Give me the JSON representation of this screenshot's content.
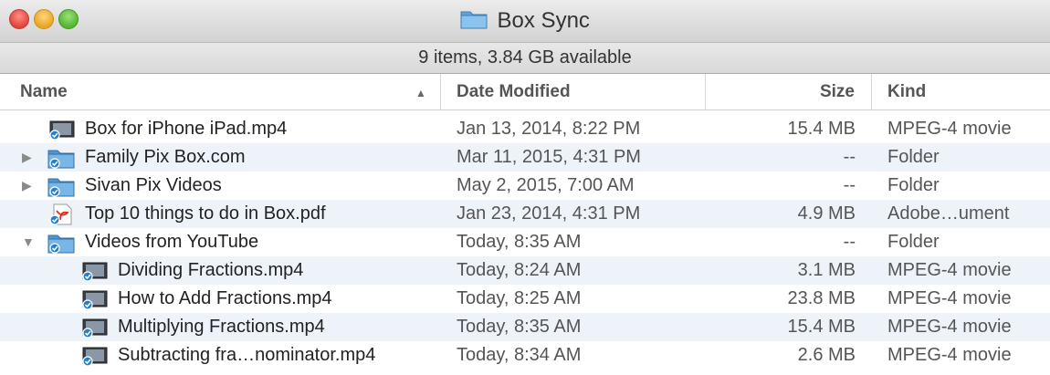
{
  "window": {
    "title": "Box Sync",
    "status": "9 items, 3.84 GB available",
    "title_icon": "folder-icon"
  },
  "columns": {
    "name": "Name",
    "date": "Date Modified",
    "size": "Size",
    "kind": "Kind",
    "sort_indicator": "▲"
  },
  "rows": [
    {
      "name": "Box for iPhone iPad.mp4",
      "date": "Jan 13, 2014, 8:22 PM",
      "size": "15.4 MB",
      "kind": "MPEG-4 movie",
      "icon": "movie-icon",
      "level": 0,
      "disclosure": ""
    },
    {
      "name": "Family Pix Box.com",
      "date": "Mar 11, 2015, 4:31 PM",
      "size": "--",
      "kind": "Folder",
      "icon": "folder-icon",
      "level": 0,
      "disclosure": "▶"
    },
    {
      "name": "Sivan Pix Videos",
      "date": "May 2, 2015, 7:00 AM",
      "size": "--",
      "kind": "Folder",
      "icon": "folder-icon",
      "level": 0,
      "disclosure": "▶"
    },
    {
      "name": "Top 10 things to do in Box.pdf",
      "date": "Jan 23, 2014, 4:31 PM",
      "size": "4.9 MB",
      "kind": "Adobe…ument",
      "icon": "pdf-icon",
      "level": 0,
      "disclosure": ""
    },
    {
      "name": "Videos from YouTube",
      "date": "Today, 8:35 AM",
      "size": "--",
      "kind": "Folder",
      "icon": "folder-icon",
      "level": 0,
      "disclosure": "▼"
    },
    {
      "name": "Dividing Fractions.mp4",
      "date": "Today, 8:24 AM",
      "size": "3.1 MB",
      "kind": "MPEG-4 movie",
      "icon": "movie-icon",
      "level": 1,
      "disclosure": ""
    },
    {
      "name": "How to Add Fractions.mp4",
      "date": "Today, 8:25 AM",
      "size": "23.8 MB",
      "kind": "MPEG-4 movie",
      "icon": "movie-icon",
      "level": 1,
      "disclosure": ""
    },
    {
      "name": "Multiplying Fractions.mp4",
      "date": "Today, 8:35 AM",
      "size": "15.4 MB",
      "kind": "MPEG-4 movie",
      "icon": "movie-icon",
      "level": 1,
      "disclosure": ""
    },
    {
      "name": "Subtracting fra…nominator.mp4",
      "date": "Today, 8:34 AM",
      "size": "2.6 MB",
      "kind": "MPEG-4 movie",
      "icon": "movie-icon",
      "level": 1,
      "disclosure": ""
    }
  ],
  "colors": {
    "row_stripe": "#eef3fa",
    "folder": "#6aaee0",
    "sync_badge": "#1f7fd1"
  }
}
